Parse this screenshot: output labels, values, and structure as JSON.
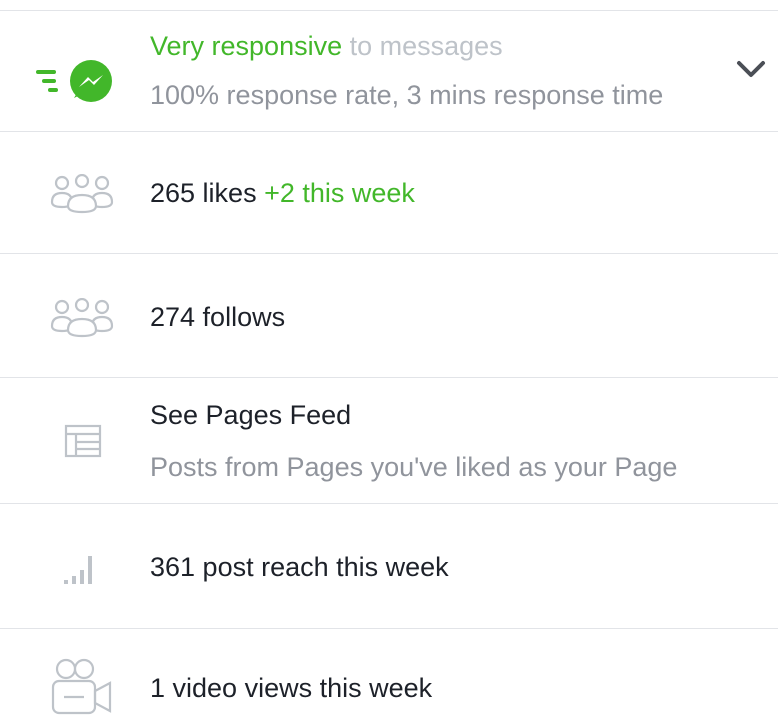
{
  "responsiveness": {
    "badge": "Very responsive",
    "suffix": " to messages",
    "detail": "100% response rate, 3 mins response time"
  },
  "likes": {
    "count": "265 likes",
    "delta": "+2 this week"
  },
  "follows": {
    "count": "274 follows"
  },
  "pages_feed": {
    "title": "See Pages Feed",
    "subtitle": "Posts from Pages you've liked as your Page"
  },
  "post_reach": {
    "text": "361 post reach this week"
  },
  "video_views": {
    "text": "1 video views this week"
  },
  "icons": {
    "responsive": "messenger-bolt-icon",
    "likes": "people-group-icon",
    "follows": "people-group-icon",
    "feed": "news-feed-icon",
    "reach": "signal-bars-icon",
    "video": "video-camera-icon",
    "expand": "chevron-down-icon"
  },
  "colors": {
    "accent": "#42b72a",
    "text": "#1d2129",
    "secondary": "#90949c",
    "divider": "#e2e4e8"
  }
}
